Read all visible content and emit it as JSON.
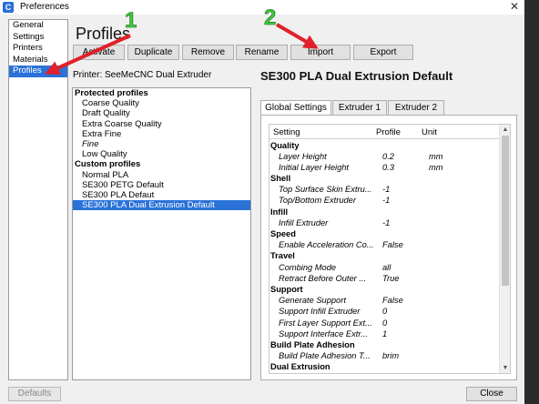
{
  "window": {
    "title": "Preferences",
    "app_icon_letter": "C",
    "close_glyph": "✕"
  },
  "sidebar": {
    "items": [
      {
        "label": "General",
        "selected": false
      },
      {
        "label": "Settings",
        "selected": false
      },
      {
        "label": "Printers",
        "selected": false
      },
      {
        "label": "Materials",
        "selected": false
      },
      {
        "label": "Profiles",
        "selected": true
      }
    ]
  },
  "page": {
    "title": "Profiles"
  },
  "toolbar": {
    "activate": "Activate",
    "duplicate": "Duplicate",
    "remove": "Remove",
    "rename": "Rename",
    "import": "Import",
    "export": "Export"
  },
  "printer_label": "Printer: SeeMeCNC Dual Extruder",
  "profile_list": {
    "protected_header": "Protected profiles",
    "protected": [
      {
        "label": "Coarse Quality",
        "italic": false
      },
      {
        "label": "Draft Quality",
        "italic": false
      },
      {
        "label": "Extra Coarse Quality",
        "italic": false
      },
      {
        "label": "Extra Fine",
        "italic": false
      },
      {
        "label": "Fine",
        "italic": true
      },
      {
        "label": "Low Quality",
        "italic": false
      }
    ],
    "custom_header": "Custom profiles",
    "custom": [
      {
        "label": "Normal PLA",
        "selected": false
      },
      {
        "label": "SE300 PETG Default",
        "selected": false
      },
      {
        "label": "SE300 PLA Defaut",
        "selected": false
      },
      {
        "label": "SE300 PLA Dual Extrusion Default",
        "selected": true
      }
    ]
  },
  "profile_detail": {
    "title": "SE300 PLA Dual Extrusion Default",
    "tabs": [
      "Global Settings",
      "Extruder 1",
      "Extruder 2"
    ],
    "active_tab": 0,
    "columns": {
      "setting": "Setting",
      "profile": "Profile",
      "unit": "Unit"
    },
    "rows": [
      {
        "type": "cat",
        "name": "Quality"
      },
      {
        "type": "set",
        "name": "Layer Height",
        "value": "0.2",
        "unit": "mm"
      },
      {
        "type": "set",
        "name": "Initial Layer Height",
        "value": "0.3",
        "unit": "mm"
      },
      {
        "type": "cat",
        "name": "Shell"
      },
      {
        "type": "set",
        "name": "Top Surface Skin Extru...",
        "value": "-1",
        "unit": ""
      },
      {
        "type": "set",
        "name": "Top/Bottom Extruder",
        "value": "-1",
        "unit": ""
      },
      {
        "type": "cat",
        "name": "Infill"
      },
      {
        "type": "set",
        "name": "Infill Extruder",
        "value": "-1",
        "unit": ""
      },
      {
        "type": "cat",
        "name": "Speed"
      },
      {
        "type": "set",
        "name": "Enable Acceleration Co...",
        "value": "False",
        "unit": ""
      },
      {
        "type": "cat",
        "name": "Travel"
      },
      {
        "type": "set",
        "name": "Combing Mode",
        "value": "all",
        "unit": ""
      },
      {
        "type": "set",
        "name": "Retract Before Outer ...",
        "value": "True",
        "unit": ""
      },
      {
        "type": "cat",
        "name": "Support"
      },
      {
        "type": "set",
        "name": "Generate Support",
        "value": "False",
        "unit": ""
      },
      {
        "type": "set",
        "name": "Support Infill Extruder",
        "value": "0",
        "unit": ""
      },
      {
        "type": "set",
        "name": "First Layer Support Ext...",
        "value": "0",
        "unit": ""
      },
      {
        "type": "set",
        "name": "Support Interface Extr...",
        "value": "1",
        "unit": ""
      },
      {
        "type": "cat",
        "name": "Build Plate Adhesion"
      },
      {
        "type": "set",
        "name": "Build Plate Adhesion T...",
        "value": "brim",
        "unit": ""
      },
      {
        "type": "cat",
        "name": "Dual Extrusion"
      }
    ]
  },
  "footer": {
    "defaults": "Defaults",
    "close": "Close"
  },
  "annotations": {
    "color": "#e0202a",
    "label_color": "#3cc93c",
    "marker_1": "1",
    "marker_2": "2"
  }
}
